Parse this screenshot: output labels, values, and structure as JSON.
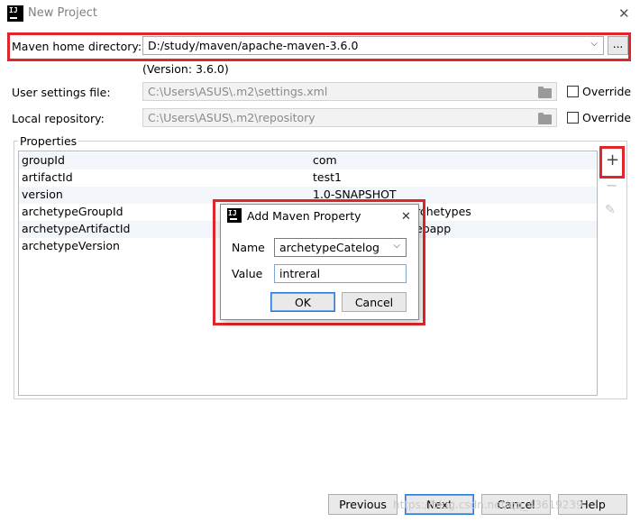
{
  "window": {
    "title": "New Project",
    "logo_text": "IJ"
  },
  "maven": {
    "home_label": "Maven home directory:",
    "home_value": "D:/study/maven/apache-maven-3.6.0",
    "browse_label": "...",
    "version_text": "(Version: 3.6.0)",
    "settings_label": "User settings file:",
    "settings_value": "C:\\Users\\ASUS\\.m2\\settings.xml",
    "repo_label": "Local repository:",
    "repo_value": "C:\\Users\\ASUS\\.m2\\repository",
    "override_label": "Override"
  },
  "properties": {
    "label": "Properties",
    "rows": [
      {
        "key": "groupId",
        "value": "com"
      },
      {
        "key": "artifactId",
        "value": "test1"
      },
      {
        "key": "version",
        "value": "1.0-SNAPSHOT"
      },
      {
        "key": "archetypeGroupId",
        "value": "rchetypes"
      },
      {
        "key": "archetypeArtifactId",
        "value": "ebapp"
      },
      {
        "key": "archetypeVersion",
        "value": ""
      }
    ],
    "add_symbol": "+",
    "remove_symbol": "−",
    "edit_symbol": "✎"
  },
  "dialog": {
    "title": "Add Maven Property",
    "logo_text": "IJ",
    "name_label": "Name",
    "name_value": "archetypeCatelog",
    "value_label": "Value",
    "value_value": "intreral",
    "ok_label": "OK",
    "cancel_label": "Cancel"
  },
  "footer": {
    "previous_label": "Previous",
    "next_label": "Next",
    "cancel_label": "Cancel",
    "help_label": "Help",
    "watermark": "https://blog.csdn.net/qq_43619239"
  }
}
